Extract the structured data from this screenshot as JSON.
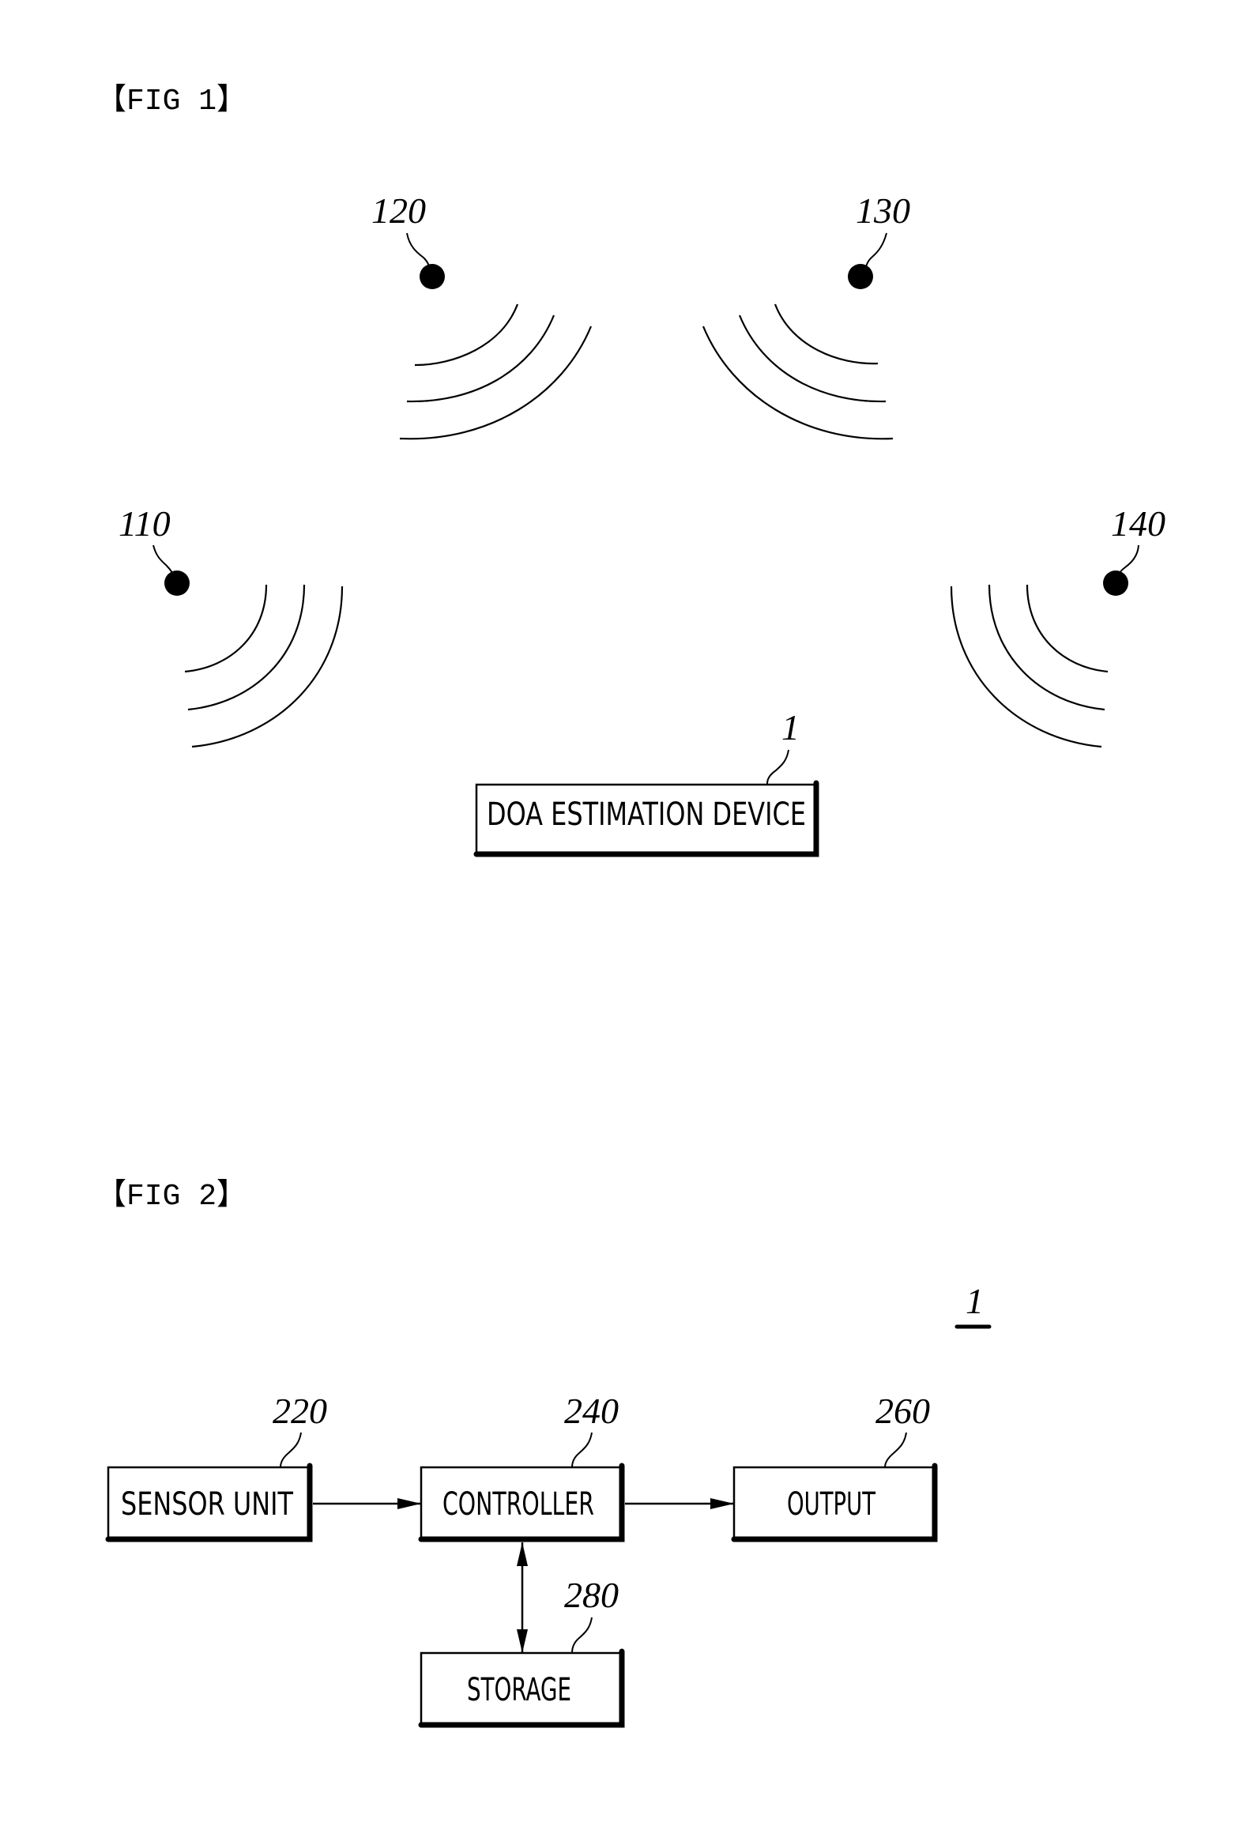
{
  "figures": [
    {
      "id": "fig1",
      "title": "【FIG 1】",
      "sources": [
        {
          "ref": "110",
          "name": "source-110"
        },
        {
          "ref": "120",
          "name": "source-120"
        },
        {
          "ref": "130",
          "name": "source-130"
        },
        {
          "ref": "140",
          "name": "source-140"
        }
      ],
      "device": {
        "ref": "1",
        "label": "DOA ESTIMATION DEVICE"
      }
    },
    {
      "id": "fig2",
      "title": "【FIG 2】",
      "system_ref": "1",
      "blocks": [
        {
          "ref": "220",
          "label": "SENSOR UNIT"
        },
        {
          "ref": "240",
          "label": "CONTROLLER"
        },
        {
          "ref": "260",
          "label": "OUTPUT"
        },
        {
          "ref": "280",
          "label": "STORAGE"
        }
      ],
      "connections": [
        {
          "from": "SENSOR UNIT",
          "to": "CONTROLLER",
          "direction": "one-way"
        },
        {
          "from": "CONTROLLER",
          "to": "OUTPUT",
          "direction": "one-way"
        },
        {
          "from": "CONTROLLER",
          "to": "STORAGE",
          "direction": "two-way"
        }
      ]
    }
  ]
}
